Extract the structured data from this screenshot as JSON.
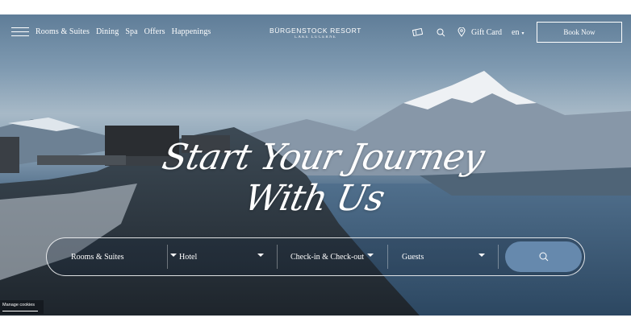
{
  "nav": {
    "links": [
      "Rooms & Suites",
      "Dining",
      "Spa",
      "Offers",
      "Happenings"
    ],
    "brand_name": "BÜRGENSTOCK RESORT",
    "brand_sub": "LAKE LUCERNE",
    "icons": [
      "ticket-icon",
      "search-icon",
      "location-pin-icon"
    ],
    "gift_card": "Gift Card",
    "language": "en",
    "book_now": "Book Now"
  },
  "hero": {
    "headline": "Start Your Journey With Us"
  },
  "booking": {
    "room_type": "Rooms & Suites",
    "property": "Hotel",
    "dates": "Check-in & Check-out",
    "guests": "Guests"
  },
  "cookies": {
    "label": "Manage cookies"
  },
  "colors": {
    "search_button": "#6689ad",
    "overlay_border": "#ffffff"
  }
}
